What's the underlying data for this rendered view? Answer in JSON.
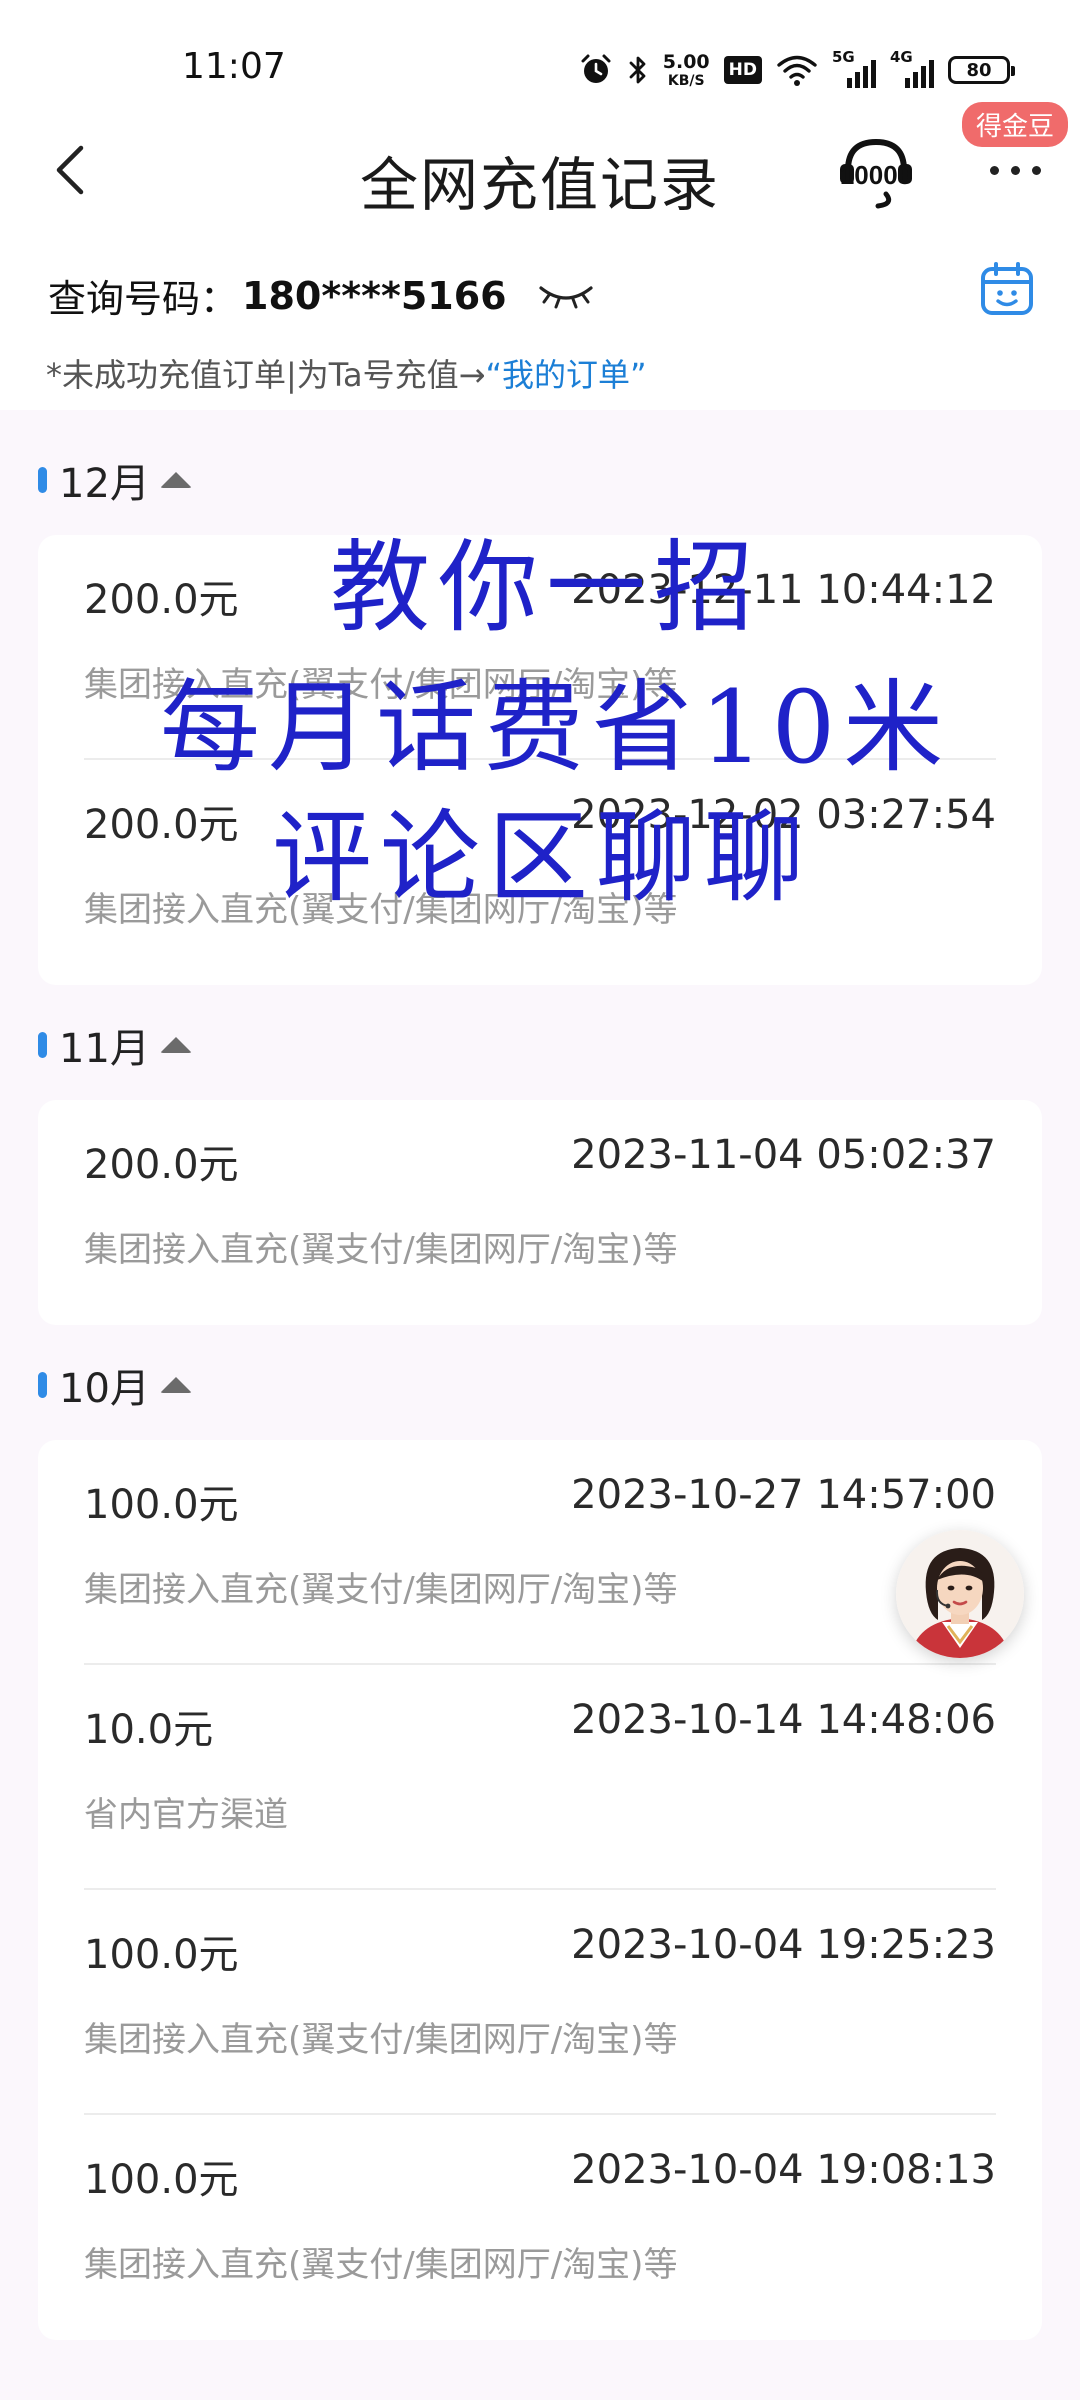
{
  "status_bar": {
    "time": "11:07",
    "speed_value": "5.00",
    "speed_unit": "KB/S",
    "hd_label": "HD",
    "net1": "5G",
    "net2": "4G",
    "battery": "80",
    "icons": [
      "alarm-icon",
      "bluetooth-icon",
      "wifi-icon",
      "signal-icon"
    ]
  },
  "nav": {
    "title": "全网充值记录",
    "badge": "得金豆",
    "service_icon": "10000-service-icon",
    "more_icon": "more-icon",
    "back_icon": "back-arrow-icon"
  },
  "query": {
    "label": "查询号码：",
    "number": "180****5166",
    "eye_icon": "eye-closed-icon",
    "calendar_icon": "calendar-icon"
  },
  "hint": {
    "text": "*未成功充值订单|为Ta号充值→",
    "link": "“我的订单”"
  },
  "sections": [
    {
      "month": "12月",
      "records": [
        {
          "amount": "200.0元",
          "time": "2023-12-11 10:44:12",
          "channel": "集团接入直充(翼支付/集团网厅/淘宝)等"
        },
        {
          "amount": "200.0元",
          "time": "2023-12-02 03:27:54",
          "channel": "集团接入直充(翼支付/集团网厅/淘宝)等"
        }
      ]
    },
    {
      "month": "11月",
      "records": [
        {
          "amount": "200.0元",
          "time": "2023-11-04 05:02:37",
          "channel": "集团接入直充(翼支付/集团网厅/淘宝)等"
        }
      ]
    },
    {
      "month": "10月",
      "records": [
        {
          "amount": "100.0元",
          "time": "2023-10-27 14:57:00",
          "channel": "集团接入直充(翼支付/集团网厅/淘宝)等"
        },
        {
          "amount": "10.0元",
          "time": "2023-10-14 14:48:06",
          "channel": "省内官方渠道"
        },
        {
          "amount": "100.0元",
          "time": "2023-10-04 19:25:23",
          "channel": "集团接入直充(翼支付/集团网厅/淘宝)等"
        },
        {
          "amount": "100.0元",
          "time": "2023-10-04 19:08:13",
          "channel": "集团接入直充(翼支付/集团网厅/淘宝)等"
        }
      ]
    }
  ],
  "overlay": {
    "line1": "教你一招",
    "line2": "每月话费省10米",
    "line3": "评论区聊聊"
  },
  "colors": {
    "accent": "#2f8be6",
    "link": "#1c7fd6",
    "badge": "#f06b6b",
    "overlay_text": "#1f22c8"
  }
}
